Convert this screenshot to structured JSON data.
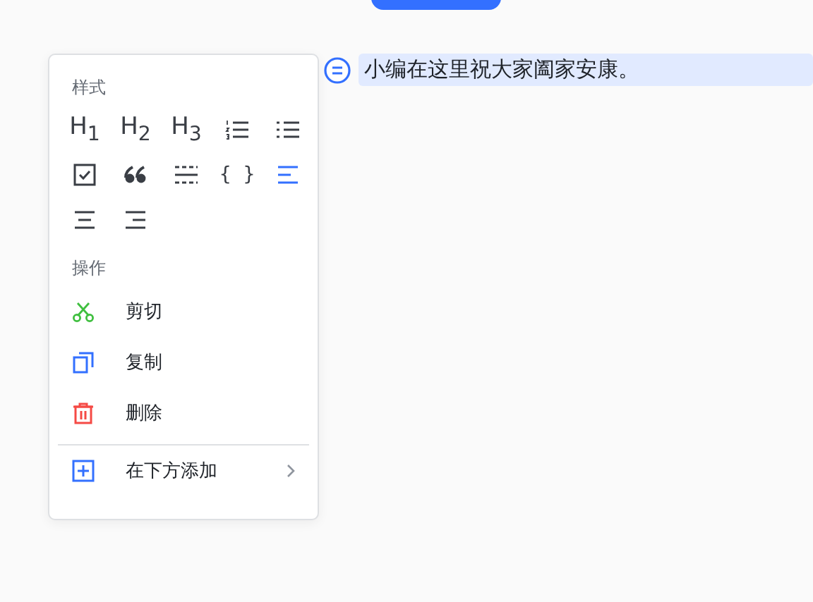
{
  "badge": {
    "visible": true
  },
  "block": {
    "text": "小编在这里祝大家阖家安康。",
    "selected": true
  },
  "menu": {
    "style_title": "样式",
    "tools": [
      {
        "kind": "heading",
        "label": "H$_{1}$",
        "selected": false
      },
      {
        "kind": "heading",
        "label": "H$_{2}$",
        "selected": false
      },
      {
        "kind": "heading",
        "label": "H$_{3}$",
        "selected": false
      },
      {
        "kind": "ordered-list",
        "selected": false
      },
      {
        "kind": "bullet-list",
        "selected": false
      },
      {
        "kind": "task",
        "selected": false
      },
      {
        "kind": "quote",
        "selected": false
      },
      {
        "kind": "divider",
        "selected": false
      },
      {
        "kind": "code",
        "label": "{ }",
        "selected": false
      },
      {
        "kind": "align-left",
        "selected": true
      },
      {
        "kind": "align-center",
        "selected": false
      },
      {
        "kind": "align-right",
        "selected": false
      }
    ],
    "action_title": "操作",
    "actions": [
      {
        "kind": "cut",
        "label": "剪切"
      },
      {
        "kind": "copy",
        "label": "复制"
      },
      {
        "kind": "delete",
        "label": "删除"
      }
    ],
    "add": {
      "label": "在下方添加",
      "submenu": true
    }
  }
}
